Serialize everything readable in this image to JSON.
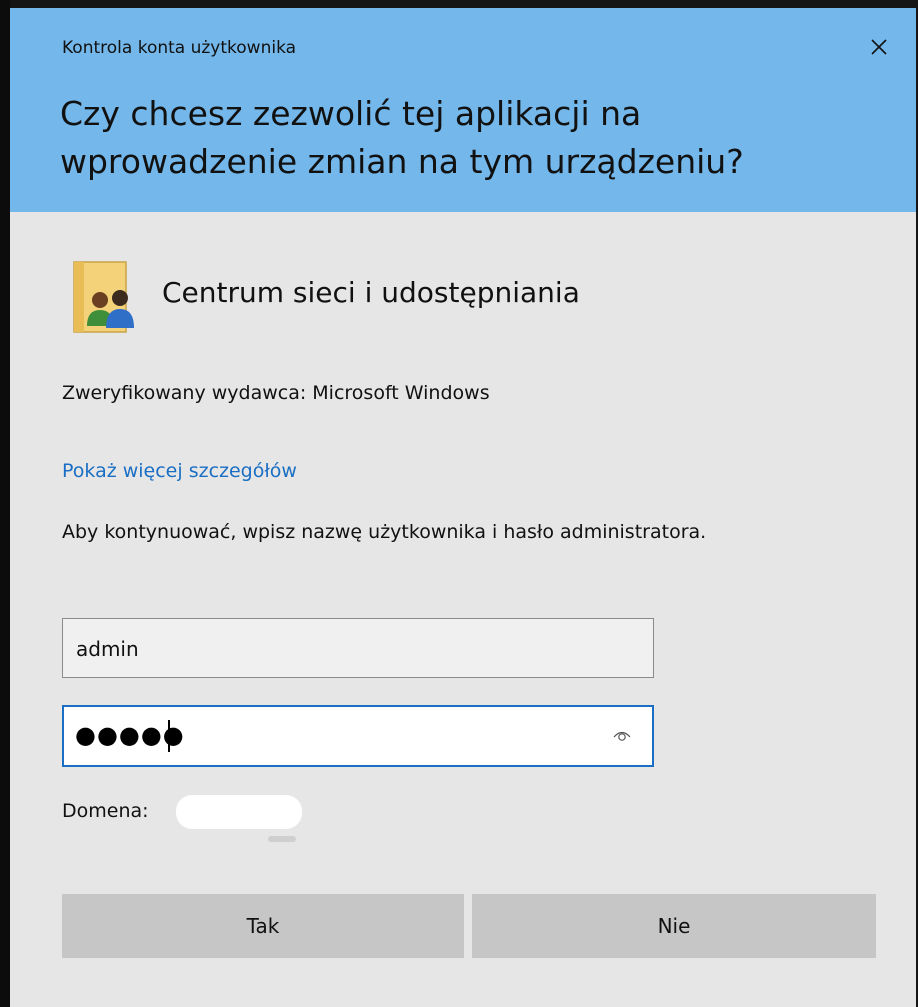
{
  "window": {
    "title": "Kontrola konta użytkownika",
    "close_icon": "close-icon"
  },
  "prompt": {
    "question": "Czy chcesz zezwolić tej aplikacji na wprowadzenie zmian na tym urządzeniu?"
  },
  "app": {
    "icon": "network-sharing-center-icon",
    "name": "Centrum sieci i udostępniania"
  },
  "publisher": "Zweryfikowany wydawca: Microsoft Windows",
  "details_link": "Pokaż więcej szczegółów",
  "instruction": "Aby kontynuować, wpisz nazwę użytkownika i hasło administratora.",
  "credentials": {
    "username": "admin",
    "password_mask": "●●●●●",
    "reveal_icon": "eye-icon"
  },
  "domain": {
    "label": "Domena:"
  },
  "buttons": {
    "yes": "Tak",
    "no": "Nie"
  },
  "colors": {
    "header": "#74b7ea",
    "accent": "#1a6fc4",
    "body": "#e6e6e6",
    "button": "#c6c6c6"
  }
}
